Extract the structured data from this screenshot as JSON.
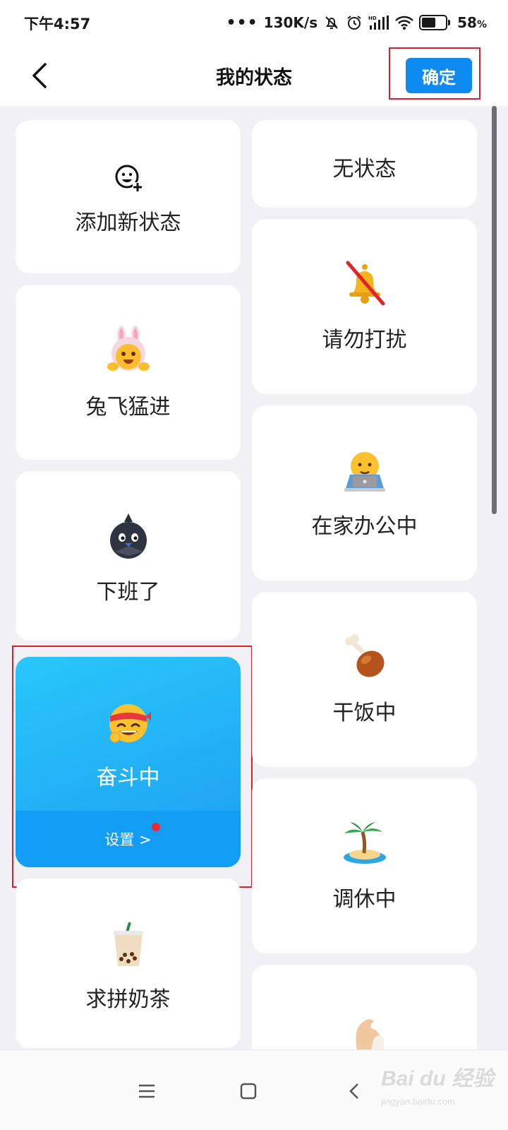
{
  "status_bar": {
    "time": "下午4:57",
    "network_speed": "130K/s",
    "battery": "58",
    "battery_unit": "%",
    "battery_level": 0.58
  },
  "header": {
    "title": "我的状态",
    "confirm_label": "确定"
  },
  "cards": {
    "add": {
      "label": "添加新状态",
      "icon": "add-emoji-icon"
    },
    "none": {
      "label": "无状态"
    },
    "dnd": {
      "label": "请勿打扰",
      "icon": "muted-bell-icon"
    },
    "rabbit": {
      "label": "兔飞猛进",
      "icon": "bunny-hat-emoji"
    },
    "wfh": {
      "label": "在家办公中",
      "icon": "laptop-worker-emoji"
    },
    "offwork": {
      "label": "下班了",
      "icon": "black-bird-emoji"
    },
    "eating": {
      "label": "干饭中",
      "icon": "drumstick-emoji"
    },
    "striving": {
      "label": "奋斗中",
      "icon": "headband-emoji",
      "settings_label": "设置 >"
    },
    "dayoff": {
      "label": "调休中",
      "icon": "palm-island-emoji"
    },
    "milktea": {
      "label": "求拼奶茶",
      "icon": "bubble-tea-emoji"
    },
    "fitness": {
      "icon": "flexed-arm-emoji"
    }
  },
  "watermark": {
    "text": "Bai du 经验",
    "sub": "jingyan.baidu.com"
  },
  "colors": {
    "accent": "#0d8bf0",
    "selected_gradient_top": "#28c7fb",
    "highlight": "#d6232b"
  }
}
